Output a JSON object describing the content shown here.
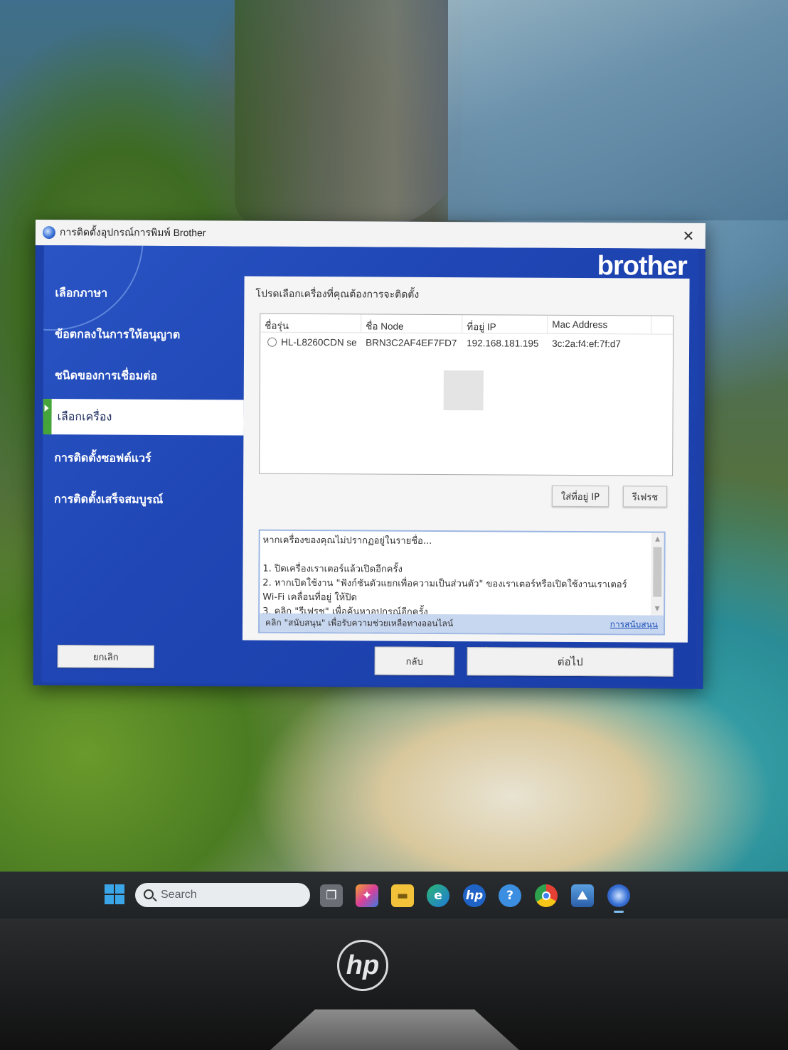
{
  "dialog": {
    "title": "การติดตั้งอุปกรณ์การพิมพ์ Brother",
    "brand": "brother",
    "steps": [
      {
        "label": "เลือกภาษา"
      },
      {
        "label": "ข้อตกลงในการให้อนุญาต"
      },
      {
        "label": "ชนิดของการเชื่อมต่อ"
      },
      {
        "label": "เลือกเครื่อง"
      },
      {
        "label": "การติดตั้งซอฟต์แวร์"
      },
      {
        "label": "การติดตั้งเสร็จสมบูรณ์"
      }
    ],
    "active_step": "เลือกเครื่อง",
    "panel_heading": "โปรดเลือกเครื่องที่คุณต้องการจะติดตั้ง",
    "columns": [
      "ชื่อรุ่น",
      "ชื่อ Node",
      "ที่อยู่ IP",
      "Mac Address"
    ],
    "devices": [
      {
        "model": "HL-L8260CDN se",
        "node": "BRN3C2AF4EF7FD7",
        "ip": "192.168.181.195",
        "mac": "3c:2a:f4:ef:7f:d7"
      }
    ],
    "buttons": {
      "specify_ip": "ใส่ที่อยู่ IP",
      "refresh": "รีเฟรช",
      "cancel": "ยกเลิก",
      "back": "กลับ",
      "next": "ต่อไป"
    },
    "help": {
      "heading": "หากเครื่องของคุณไม่ปรากฏอยู่ในรายชื่อ...",
      "item1": "1. ปิดเครื่องเราเตอร์แล้วเปิดอีกครั้ง",
      "item2": "2. หากเปิดใช้งาน \"ฟังก์ชันตัวแยกเพื่อความเป็นส่วนตัว\" ของเราเตอร์หรือเปิดใช้งานเราเตอร์",
      "item2b": "Wi-Fi เคลื่อนที่อยู่ ให้ปิด",
      "item3": "3. คลิก \"รีเฟรช\" เพื่อค้นหาอุปกรณ์อีกครั้ง",
      "footer": "คลิก \"สนับสนุน\" เพื่อรับความช่วยเหลือทางออนไลน์",
      "support_link": "การสนับสนุน"
    }
  },
  "taskbar": {
    "search_placeholder": "Search",
    "icons": [
      "windows-start-icon",
      "task-view-icon",
      "copilot-icon",
      "file-explorer-icon",
      "edge-icon",
      "hp-app-icon",
      "help-icon",
      "chrome-icon",
      "photos-icon",
      "brother-installer-icon"
    ]
  },
  "monitor": {
    "logo": "hp"
  },
  "colors": {
    "dialog_blue": "#1f46b4",
    "active_step_marker": "#46a53a",
    "taskbar": "#202325"
  }
}
